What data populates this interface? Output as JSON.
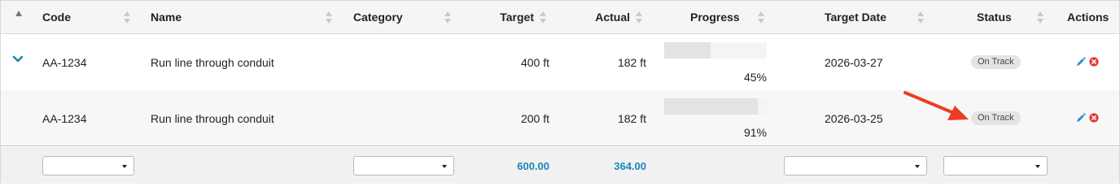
{
  "header": {
    "code": "Code",
    "name": "Name",
    "category": "Category",
    "target": "Target",
    "actual": "Actual",
    "progress": "Progress",
    "target_date": "Target Date",
    "status": "Status",
    "actions": "Actions"
  },
  "rows": [
    {
      "code": "AA-1234",
      "name": "Run line through conduit",
      "category": "",
      "target": "400 ft",
      "actual": "182 ft",
      "progress": 0.45,
      "progress_label": "45%",
      "target_date": "2026-03-27",
      "status": "On Track",
      "expanded": true
    },
    {
      "code": "AA-1234",
      "name": "Run line through conduit",
      "category": "",
      "target": "200 ft",
      "actual": "182 ft",
      "progress": 0.91,
      "progress_label": "91%",
      "target_date": "2026-03-25",
      "status": "On Track",
      "expanded": false
    }
  ],
  "footer": {
    "target_total": "600.00",
    "actual_total": "364.00",
    "code_filter": "",
    "category_filter": "",
    "target_date_filter": "",
    "status_filter": ""
  },
  "colors": {
    "accent": "#1a87b8",
    "annotation_arrow": "#ee3b24",
    "edit_icon": "#2a8fd0",
    "delete_icon": "#e03a2f"
  },
  "icons": {
    "expand": "chevron-down-icon",
    "edit": "pencil-icon",
    "delete": "close-circle-icon",
    "sort": "sort-icon"
  }
}
